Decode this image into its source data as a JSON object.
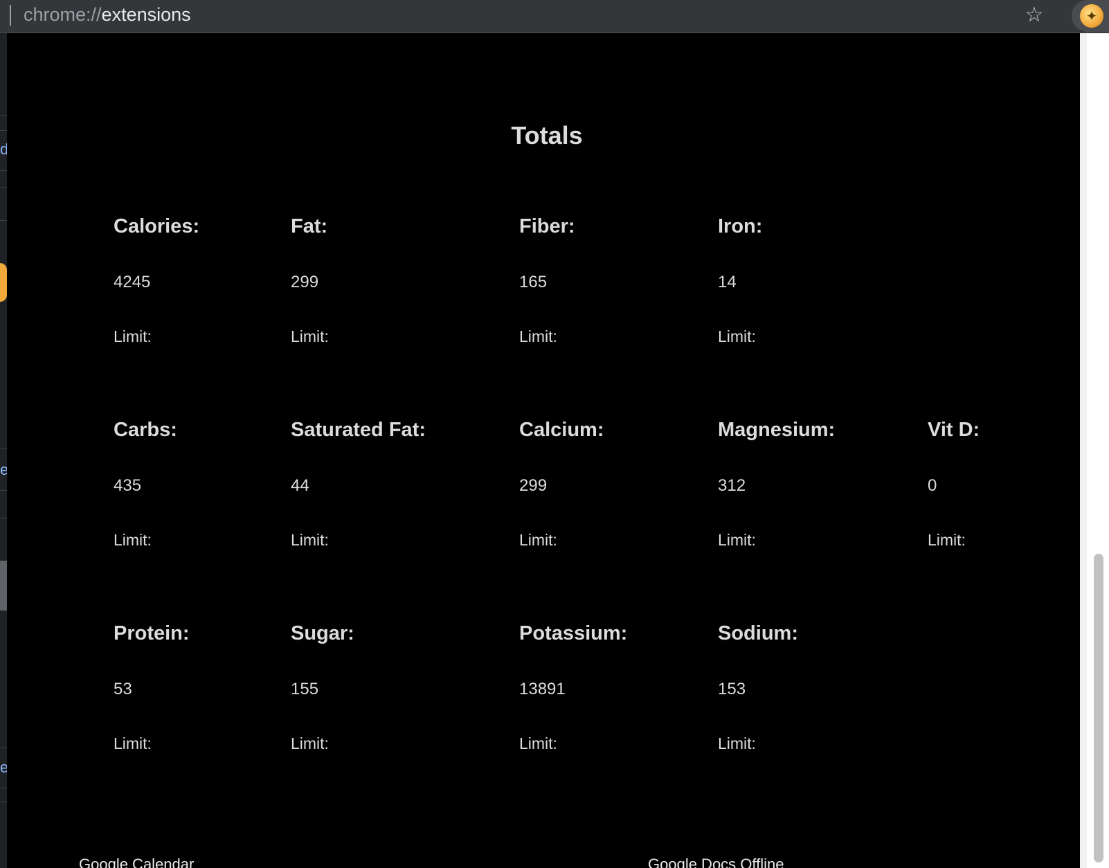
{
  "browser": {
    "url_scheme": "chrome://",
    "url_host": "extensions",
    "bookmark_icon": "star-icon",
    "extension_icon": "extension-icon"
  },
  "background_page": {
    "bottom_left_text": "Google Calendar",
    "bottom_right_text": "Google Docs Offline"
  },
  "popup": {
    "title": "Totals",
    "limit_label": "Limit:",
    "nutrients": [
      {
        "label": "Calories:",
        "value": "4245"
      },
      {
        "label": "Fat:",
        "value": "299"
      },
      {
        "label": "Fiber:",
        "value": "165"
      },
      {
        "label": "Iron:",
        "value": "14"
      },
      {
        "label": "Carbs:",
        "value": "435"
      },
      {
        "label": "Saturated Fat:",
        "value": "44"
      },
      {
        "label": "Calcium:",
        "value": "299"
      },
      {
        "label": "Magnesium:",
        "value": "312"
      },
      {
        "label": "Vit D:",
        "value": "0"
      },
      {
        "label": "Protein:",
        "value": "53"
      },
      {
        "label": "Sugar:",
        "value": "155"
      },
      {
        "label": "Potassium:",
        "value": "13891"
      },
      {
        "label": "Sodium:",
        "value": "153"
      }
    ]
  },
  "colors": {
    "popup_background": "#000000",
    "text": "#dcdcdc",
    "toolbar": "#35363a"
  }
}
